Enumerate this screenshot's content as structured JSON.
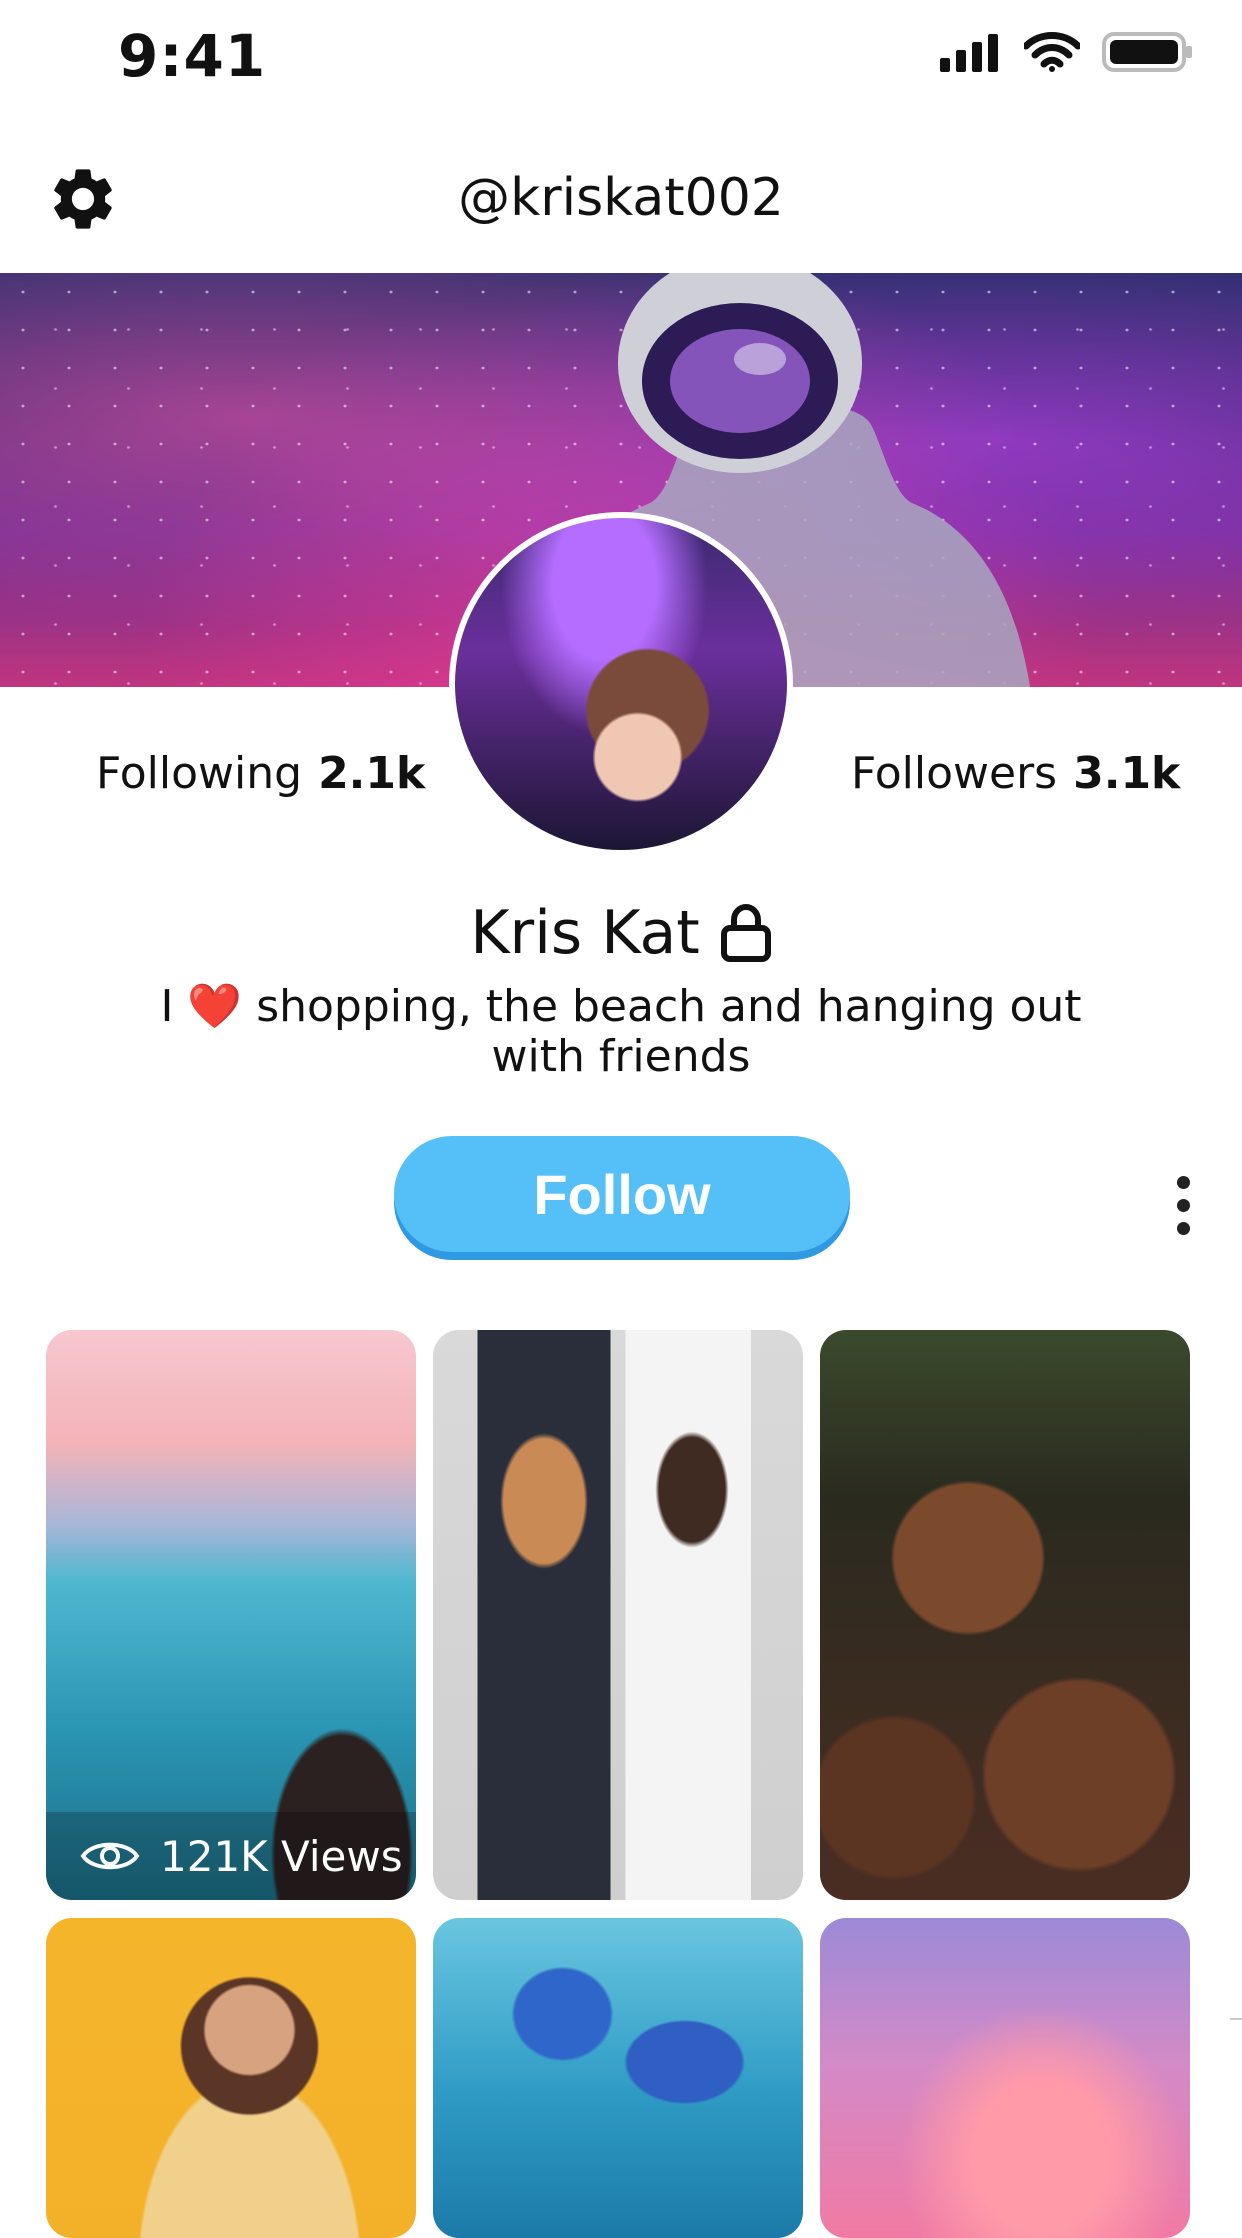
{
  "status_bar": {
    "time": "9:41"
  },
  "header": {
    "handle": "@kriskat002"
  },
  "profile": {
    "following_label": "Following",
    "following_count": "2.1k",
    "followers_label": "Followers",
    "followers_count": "3.1k",
    "name": "Kris Kat",
    "bio_prefix": "I",
    "bio_heart": "❤️",
    "bio_rest": " shopping, the beach and hanging out with friends"
  },
  "actions": {
    "follow_label": "Follow"
  },
  "grid": {
    "tile_1_views": "121K Views"
  },
  "colors": {
    "accent": "#55bff7",
    "accent_shadow": "#2f99e2",
    "heart": "#e2202a"
  },
  "icons": {
    "settings": "gear-icon",
    "lock": "lock-icon",
    "more": "more-vertical-icon",
    "views": "eye-icon",
    "signal": "cellular-signal-icon",
    "wifi": "wifi-icon",
    "battery": "battery-icon"
  }
}
